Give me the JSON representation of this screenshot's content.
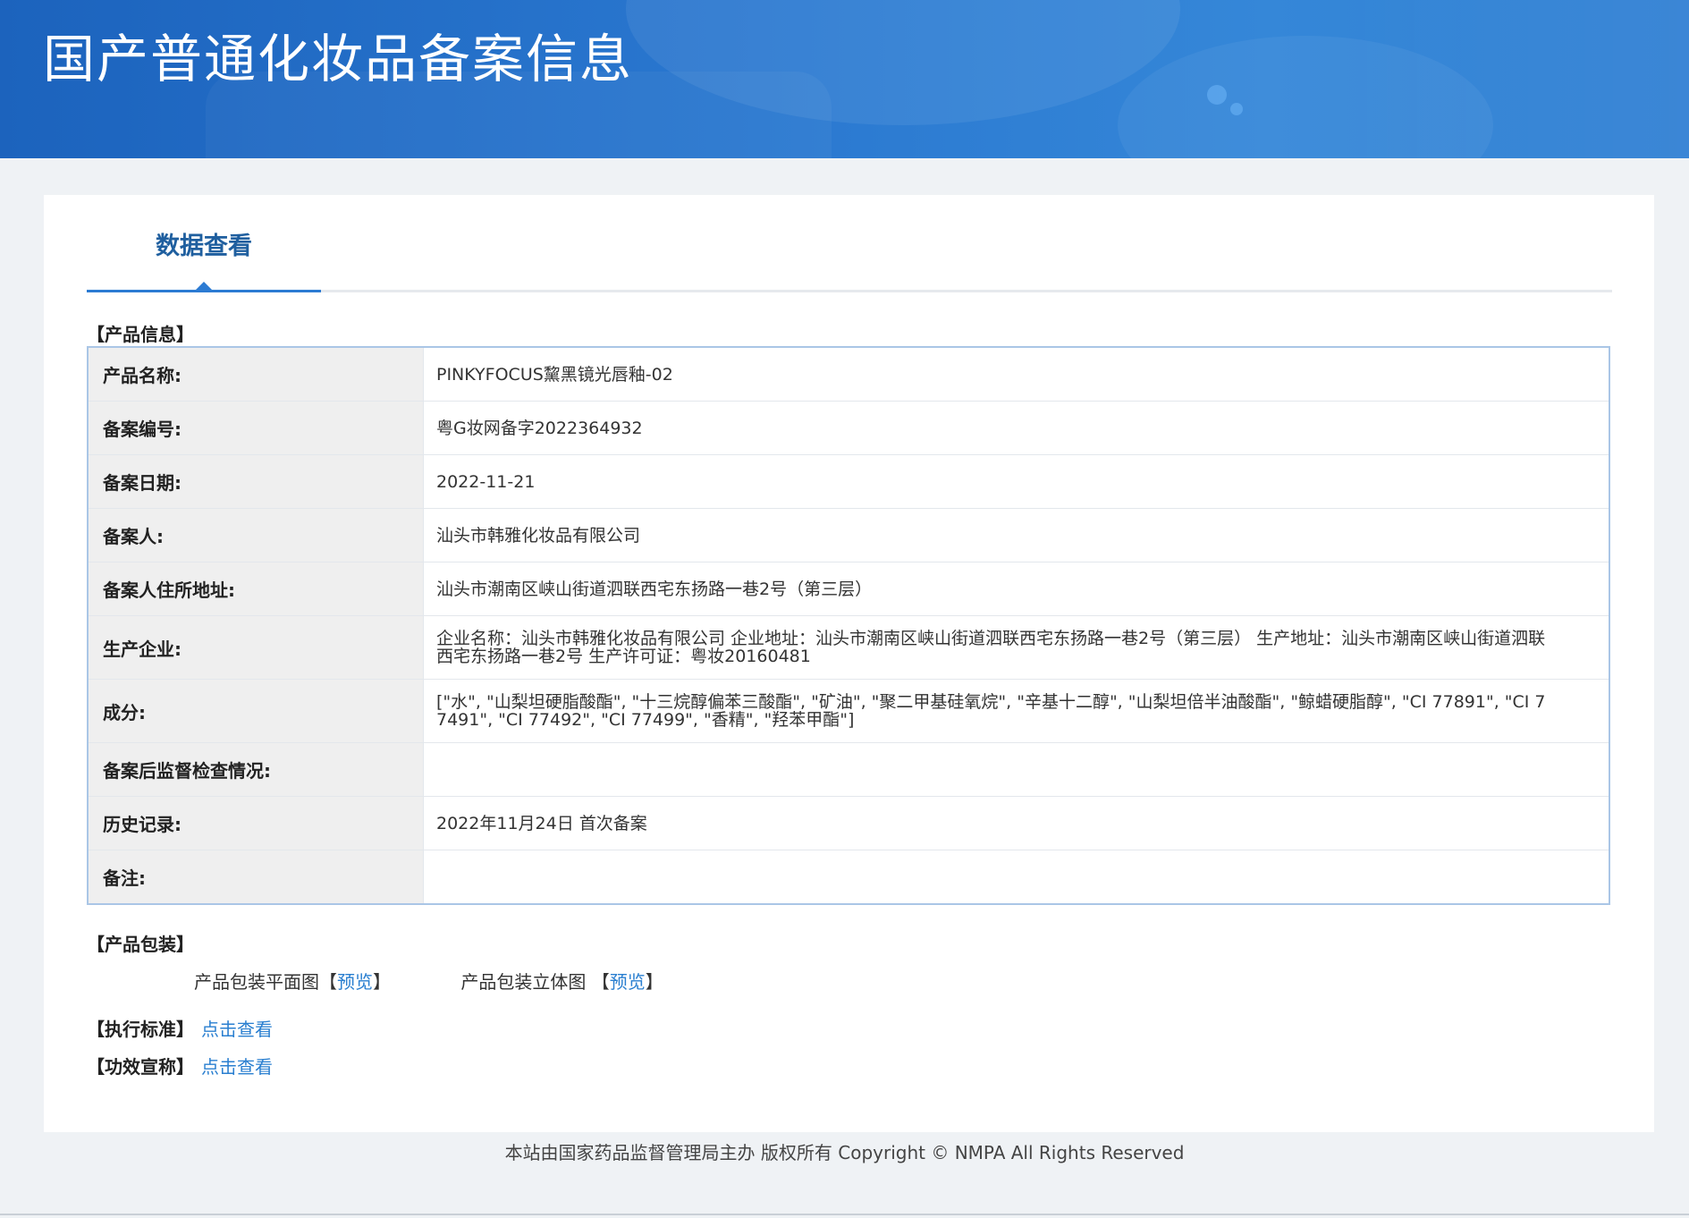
{
  "header": {
    "title": "国产普通化妆品备案信息"
  },
  "tabs": [
    {
      "label": "数据查看",
      "active": true
    }
  ],
  "product_info": {
    "section_title": "【产品信息】",
    "rows": [
      {
        "key": "产品名称:",
        "value": "PINKYFOCUS黧黑镜光唇釉-02"
      },
      {
        "key": "备案编号:",
        "value": "粤G妆网备字2022364932"
      },
      {
        "key": "备案日期:",
        "value": "2022-11-21"
      },
      {
        "key": "备案人:",
        "value": "汕头市韩雅化妆品有限公司"
      },
      {
        "key": "备案人住所地址:",
        "value": "汕头市潮南区峡山街道泗联西宅东扬路一巷2号（第三层）"
      },
      {
        "key": "生产企业:",
        "value": "企业名称：汕头市韩雅化妆品有限公司 企业地址：汕头市潮南区峡山街道泗联西宅东扬路一巷2号（第三层） 生产地址：汕头市潮南区峡山街道泗联西宅东扬路一巷2号 生产许可证：粤妆20160481"
      },
      {
        "key": "成分:",
        "value": "[\"水\", \"山梨坦硬脂酸酯\", \"十三烷醇偏苯三酸酯\", \"矿油\", \"聚二甲基硅氧烷\", \"辛基十二醇\", \"山梨坦倍半油酸酯\", \"鲸蜡硬脂醇\", \"CI 77891\", \"CI 77491\", \"CI 77492\", \"CI 77499\", \"香精\", \"羟苯甲酯\"]"
      },
      {
        "key": "备案后监督检查情况:",
        "value": ""
      },
      {
        "key": "历史记录:",
        "value": "2022年11月24日 首次备案"
      },
      {
        "key": "备注:",
        "value": ""
      }
    ]
  },
  "packaging": {
    "section_title": "【产品包装】",
    "flat_label": "产品包装平面图",
    "stereo_label": "产品包装立体图",
    "bracket_open": "【",
    "bracket_close": "】",
    "preview_link": "预览"
  },
  "standards": {
    "label": "【执行标准】",
    "link": "点击查看"
  },
  "efficacy": {
    "label": "【功效宣称】",
    "link": "点击查看"
  },
  "footer": {
    "text": "本站由国家药品监督管理局主办 版权所有 Copyright © NMPA All Rights Reserved"
  }
}
